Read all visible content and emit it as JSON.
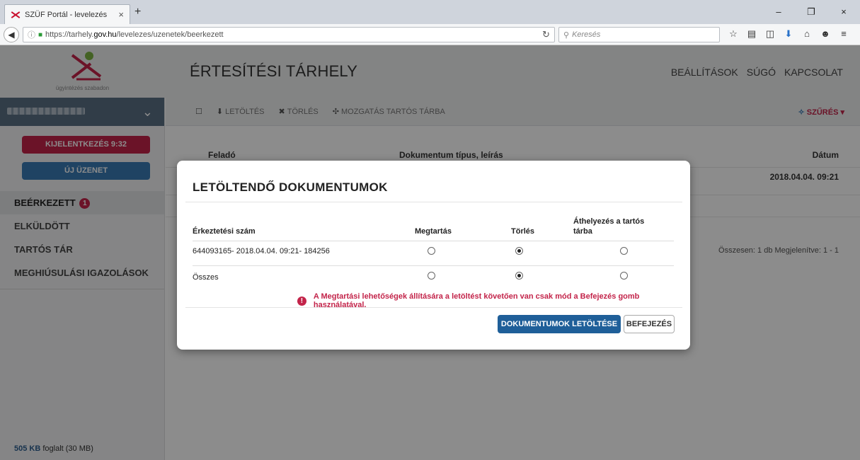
{
  "browser": {
    "tab_title": "SZÜF Portál - levelezés",
    "tab_close": "×",
    "new_tab": "+",
    "url_prefix": "https://tarhely.",
    "url_domain": "gov.hu",
    "url_path": "/levelezes/uzenetek/beerkezett",
    "search_placeholder": "Keresés",
    "window_controls": [
      "–",
      "❐",
      "×"
    ],
    "toolbar_icons": [
      "bookmark-star-icon",
      "reading-list-icon",
      "pocket-icon",
      "download-icon",
      "home-icon",
      "sync-icon",
      "menu-icon"
    ]
  },
  "header": {
    "logo_text": "ügyintézés szabadon",
    "title": "ÉRTESÍTÉSI TÁRHELY",
    "nav": [
      "BEÁLLÍTÁSOK",
      "SÚGÓ",
      "KAPCSOLAT"
    ]
  },
  "sidebar": {
    "logout_label": "KIJELENTKEZÉS 9:32",
    "new_message_label": "ÚJ ÜZENET",
    "items": [
      {
        "label": "BEÉRKEZETT",
        "badge": "1"
      },
      {
        "label": "ELKÜLDÖTT"
      },
      {
        "label": "TARTÓS TÁR"
      },
      {
        "label": "MEGHIÚSULÁSI IGAZOLÁSOK"
      }
    ],
    "storage_used": "505 KB",
    "storage_rest": "foglalt (30 MB)"
  },
  "toolbar": {
    "download": "LETÖLTÉS",
    "delete": "TÖRLÉS",
    "move": "MOZGATÁS TARTÓS TÁRBA",
    "filter": "SZŰRÉS"
  },
  "list": {
    "col_from": "Feladó",
    "col_doc": "Dokumentum típus, leírás",
    "col_date": "Dátum",
    "row_date": "2018.04.04. 09:21",
    "summary": "Összesen: 1 db  Megjelenítve: 1 - 1"
  },
  "modal": {
    "title": "LETÖLTENDŐ DOKUMENTUMOK",
    "col_number": "Érkeztetési szám",
    "col_keep": "Megtartás",
    "col_delete": "Törlés",
    "col_move": "Áthelyezés a tartós tárba",
    "rows": [
      {
        "label": "644093165- 2018.04.04. 09:21- 184256",
        "selected": "delete"
      },
      {
        "label": "Összes",
        "selected": "delete"
      }
    ],
    "warning": "A Megtartási lehetőségek állítására a letöltést követően van csak mód a Befejezés gomb használatával.",
    "download_button": "DOKUMENTUMOK LETÖLTÉSE",
    "finish_button": "BEFEJEZÉS"
  },
  "colors": {
    "accent_red": "#c3244a",
    "accent_blue": "#1f5f99"
  }
}
